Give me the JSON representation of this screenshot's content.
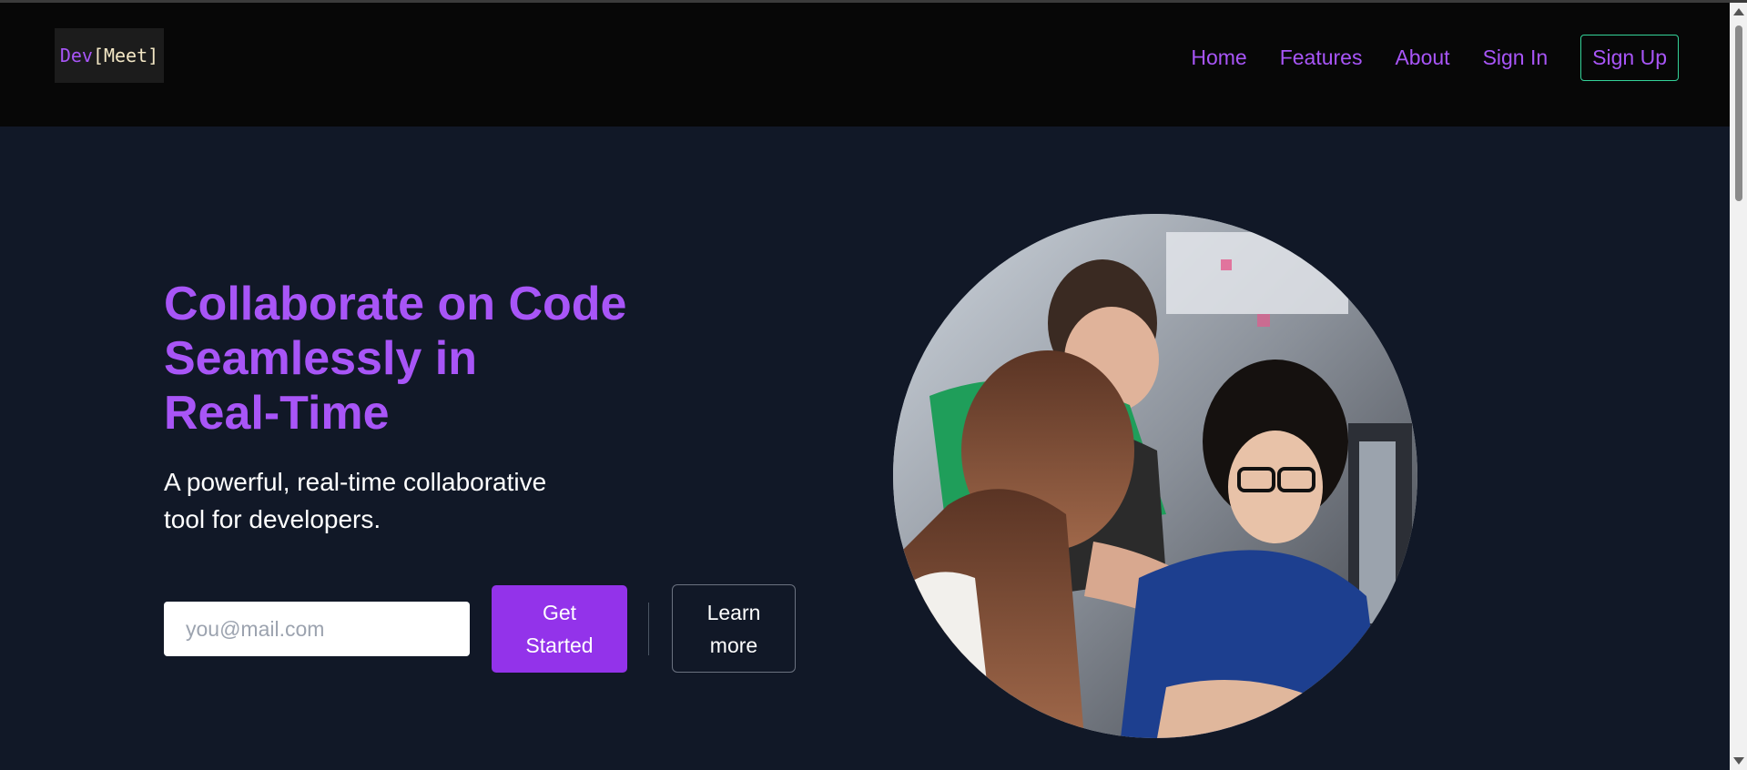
{
  "nav": {
    "logo": {
      "part1": "Dev",
      "part2": "[Meet]"
    },
    "links": [
      "Home",
      "Features",
      "About",
      "Sign In"
    ],
    "signup_label": "Sign Up"
  },
  "hero": {
    "title_lines": [
      "Collaborate on Code",
      "Seamlessly in",
      "Real-Time"
    ],
    "subtitle_lines": [
      "A powerful, real-time collaborative",
      "tool for developers."
    ],
    "email_placeholder": "you@mail.com",
    "cta_primary_lines": [
      "Get",
      "Started"
    ],
    "cta_secondary_lines": [
      "Learn",
      "more"
    ]
  },
  "colors": {
    "accent": "#a855f7",
    "primary_button": "#9333ea",
    "signup_border": "#34d399",
    "page_background": "#111827",
    "navbar_background": "#070707"
  },
  "icons": {
    "scroll_up": "scroll-up-arrow-icon",
    "scroll_down": "scroll-down-arrow-icon"
  }
}
